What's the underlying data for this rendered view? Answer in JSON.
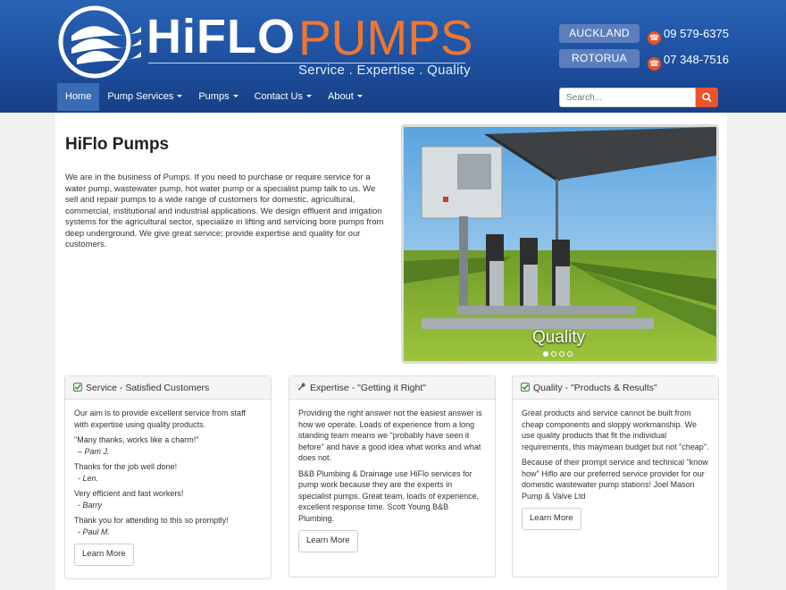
{
  "brand": {
    "name_part1": "HiFLO",
    "name_part2": "PUMPS",
    "tagline": "Service . Expertise . Quality"
  },
  "locations": [
    {
      "label": "AUCKLAND",
      "phone": "09 579-6375"
    },
    {
      "label": "ROTORUA",
      "phone": "07 348-7516"
    }
  ],
  "nav": {
    "items": [
      {
        "label": "Home",
        "active": true
      },
      {
        "label": "Pump Services",
        "dropdown": true
      },
      {
        "label": "Pumps",
        "dropdown": true
      },
      {
        "label": "Contact Us",
        "dropdown": true
      },
      {
        "label": "About",
        "dropdown": true
      }
    ],
    "search_placeholder": "Search..."
  },
  "intro": {
    "title": "HiFlo Pumps",
    "body": "We are in the business of Pumps. If you need to purchase or require service for a water pump, wastewater pump, hot water pump or a specialist pump talk to us. We sell and repair pumps to a wide range of customers for domestic, agricultural, commercial, institutional and industrial applications. We design effluent and irrigation systems for the agricultural sector, specialize in lifting and servicing bore pumps from deep underground. We give great service; provide expertise and quality for our customers."
  },
  "slider": {
    "caption": "Quality",
    "slide_count": 4,
    "active_slide": 1
  },
  "panels": [
    {
      "heading": "Service - Satisfied Customers",
      "icon": "check-square-icon",
      "paragraphs": [
        {
          "text": "Our aim is to provide excellent service from staff with expertise using quality products."
        },
        {
          "text": "\"Many thanks, works like a charm!\"",
          "sig": "– Pam J."
        },
        {
          "text": "Thanks for the job well done!",
          "sig": " - Len."
        },
        {
          "text": "Very efficient and fast workers!",
          "sig": " - Barry"
        },
        {
          "text": "Thank you for attending to this so promptly!",
          "sig": " - Paul M."
        }
      ],
      "button": "Learn More"
    },
    {
      "heading": "Expertise - \"Getting it Right\"",
      "icon": "wrench-icon",
      "paragraphs": [
        {
          "text": "Providing the right answer not the easiest answer is how we operate. Loads of experience from a long standing team means we \"probably have seen it before\" and have a good idea what works and what does not."
        },
        {
          "text": "B&B Plumbing & Drainage use HiFlo services for pump work because they are the experts in specialist pumps. Great team, loads of experience, excellent response time. Scott Young B&B Plumbing."
        }
      ],
      "button": "Learn More"
    },
    {
      "heading": "Quality - \"Products & Results\"",
      "icon": "check-square-icon",
      "paragraphs": [
        {
          "text": "Great products and service cannot be built from cheap components and sloppy workmanship. We use quality products that fit the individual requirements, this maymean budget but not \"cheap\"."
        },
        {
          "text": "Because of their prompt service and technical \"know how\" Hiflo are our preferred service provider for our domestic wastewater pump stations! Joel Mason Pump & Valve Ltd"
        }
      ],
      "button": "Learn More"
    }
  ],
  "colors": {
    "header_blue": "#1d4f9e",
    "accent_orange": "#f0762e",
    "search_button": "#e8542c",
    "check_green": "#3a9a3a"
  }
}
